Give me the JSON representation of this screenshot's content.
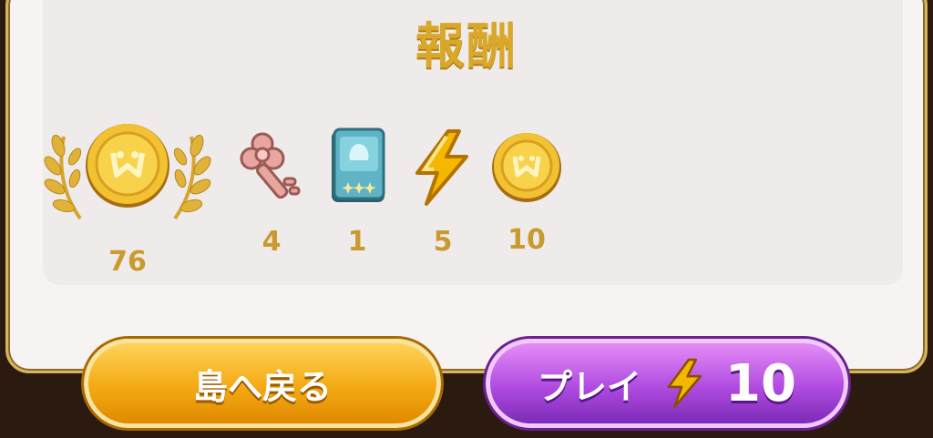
{
  "title": "報酬",
  "rewards": [
    {
      "icon": "gold-coin-icon",
      "count": "76",
      "featured": true
    },
    {
      "icon": "pink-key-icon",
      "count": "4"
    },
    {
      "icon": "teal-card-pack-icon",
      "count": "1"
    },
    {
      "icon": "lightning-bolt-icon",
      "count": "5"
    },
    {
      "icon": "gold-coin-icon",
      "count": "10"
    }
  ],
  "buttons": {
    "back_label": "島へ戻る",
    "play_label": "プレイ",
    "play_cost": "10",
    "play_cost_icon": "lightning-bolt-icon"
  },
  "colors": {
    "accent_gold": "#d9a82a",
    "back_button": "#f3a913",
    "play_button": "#b04be0"
  }
}
